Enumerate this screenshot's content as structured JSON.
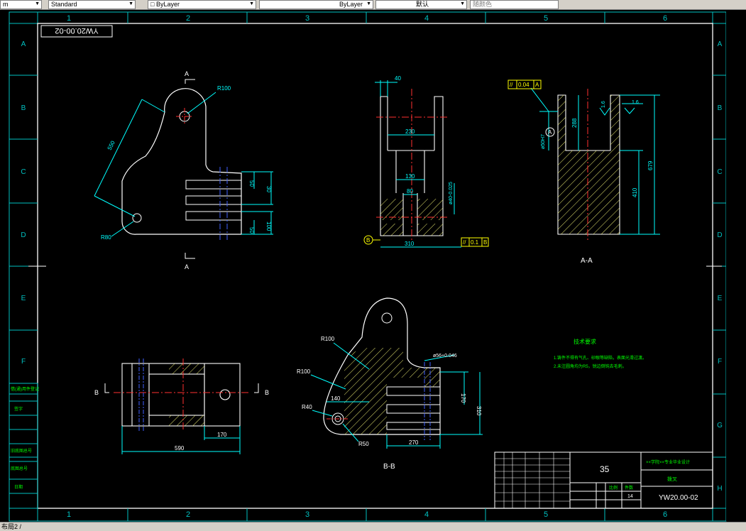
{
  "toolbar": {
    "layer_left": "m",
    "text_style": "Standard",
    "layer_dropdown": "ByLayer",
    "linetype_dropdown": "ByLayer",
    "lineweight_dropdown": "默认",
    "color_dropdown": "随颜色"
  },
  "drawing": {
    "title_block_code_rotated": "YW20.00-02",
    "column_markers": [
      "1",
      "2",
      "3",
      "4",
      "5",
      "6"
    ],
    "row_markers": [
      "A",
      "B",
      "C",
      "D",
      "E",
      "F",
      "G",
      "H"
    ],
    "section_a_label": "A",
    "section_b_label": "B",
    "section_aa_caption": "A-A",
    "section_bb_caption": "B-B",
    "datum_a": "A",
    "datum_b": "B",
    "front_view": {
      "r100": "R100",
      "r80": "R80",
      "d550": "550",
      "d50_top": "50",
      "d30": "30",
      "d100": "100",
      "d50_bottom": "50"
    },
    "side_view": {
      "d40": "40",
      "d230": "230",
      "d130": "130",
      "d80": "80",
      "d310": "310",
      "dia_fit": "ø40-0.025",
      "tol_parallel": "//",
      "tol_value": "0.1",
      "tol_datum": "B"
    },
    "section_aa": {
      "tol_parallel": "//",
      "tol_value": "0.04",
      "tol_datum": "A",
      "d288": "288",
      "d679": "679",
      "d410": "410",
      "dia_bore": "ø50H7",
      "rough_1": "1.6",
      "rough_2": "1.6"
    },
    "section_bb": {
      "r100_a": "R100",
      "r100_b": "R100",
      "r40": "R40",
      "r50": "R50",
      "d140": "140",
      "d170": "170",
      "d310": "310",
      "d270": "270",
      "dia_top": "ø56+0.046"
    },
    "plan_view": {
      "d590": "590",
      "d170": "170"
    },
    "tech_requirements_title": "技术要求",
    "tech_requirements_lines": [
      "1.铸件不得有气孔、砂眼等缺陷，表面光滑过渡。",
      "2.未注圆角均为R5，锐边倒钝去毛刺。"
    ],
    "title_block": {
      "material": "35",
      "school": "××学院××专业毕业设计",
      "part_name": "拨叉",
      "drawing_number": "YW20.00-02",
      "scale_label": "比例",
      "quantity_label": "件数",
      "sheet_value": "14"
    },
    "left_strip_labels": [
      "借(通)用件登记",
      "旧底图总号",
      "底图总号",
      "签字",
      "日期"
    ]
  },
  "status": {
    "tab": "布局2"
  }
}
